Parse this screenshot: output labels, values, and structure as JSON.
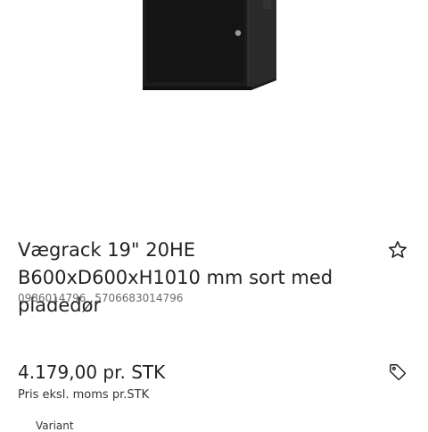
{
  "product": {
    "title": "Vægrack 19\" 20HE B600xD600xH1010 mm sort med pladedør",
    "sku": "0986014796",
    "ean": "5706683014796",
    "price": "4.179,00 pr. STK",
    "price_note": "Pris eksl. moms pr.STK",
    "variant_label": "Variant"
  },
  "icons": {
    "favorite": "star-outline-icon",
    "price_tag": "tag-icon"
  },
  "colors": {
    "background": "#ffffff",
    "text": "#222222",
    "muted": "#6b6b6b",
    "cabinet": "#1c1c1c"
  }
}
